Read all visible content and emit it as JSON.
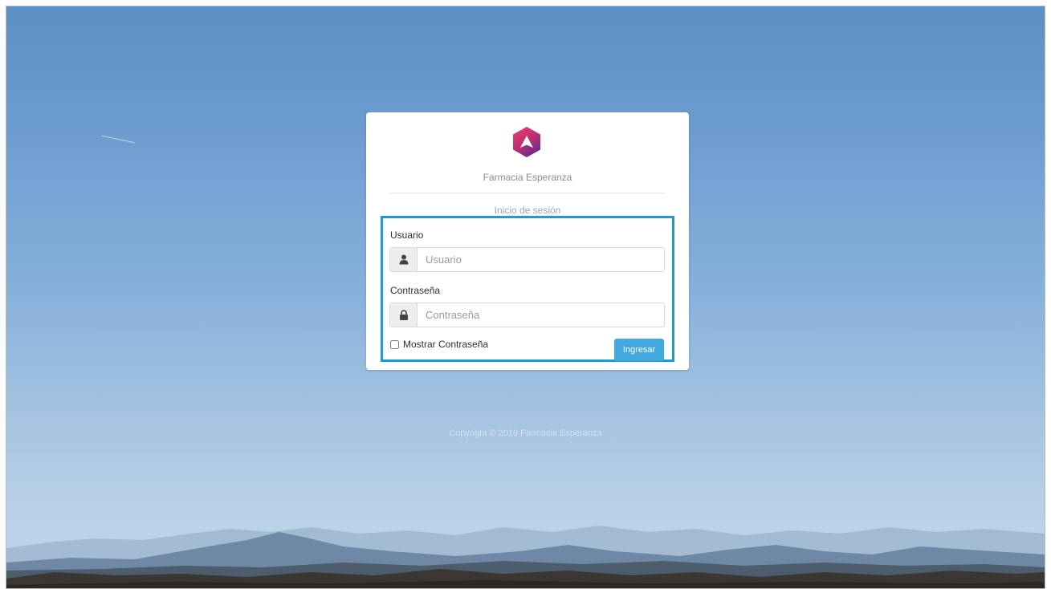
{
  "brand": {
    "name": "Farmacia Esperanza",
    "logo_icon": "pharmacy-hexagon-logo",
    "logo_colors": [
      "#e0356d",
      "#7a2c8c",
      "#ffffff"
    ]
  },
  "login": {
    "subtitle": "Inicio de sesión",
    "username": {
      "label": "Usuario",
      "placeholder": "Usuario",
      "value": "",
      "icon": "user-icon"
    },
    "password": {
      "label": "Contraseña",
      "placeholder": "Contraseña",
      "value": "",
      "icon": "lock-icon"
    },
    "show_password_label": "Mostrar Contraseña",
    "show_password_checked": false,
    "submit_label": "Ingresar",
    "highlight_color": "#1a9ad6",
    "button_color": "#41a9e0"
  },
  "footer": {
    "copyright": "Copyright © 2019 Farmacia Esperanza"
  }
}
